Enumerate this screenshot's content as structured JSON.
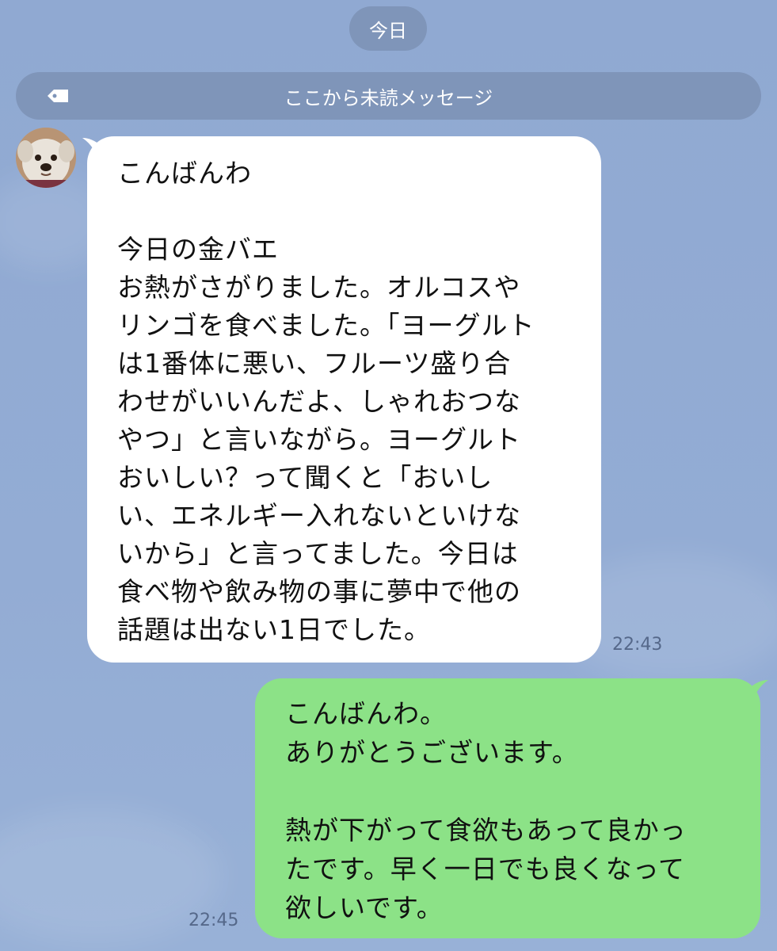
{
  "chat": {
    "date_label": "今日",
    "unread_label": "ここから未読メッセージ"
  },
  "incoming": {
    "avatar_icon": "dog-avatar-icon",
    "lines": [
      "こんばんわ",
      "",
      "今日の金バエ",
      "お熱がさがりました。オルコスや",
      "リンゴを食べました。「ヨーグルト",
      "は1番体に悪い、フルーツ盛り合",
      "わせがいいんだよ、しゃれおつな",
      "やつ」と言いながら。ヨーグルト",
      "おいしい？って聞くと「おいし",
      "い、エネルギー入れないといけな",
      "いから」と言ってました。今日は",
      "食べ物や飲み物の事に夢中で他の",
      "話題は出ない1日でした。"
    ],
    "time": "22:43"
  },
  "outgoing": {
    "lines": [
      "こんばんわ。",
      "ありがとうございます。",
      "",
      "熱が下がって食欲もあって良かっ",
      "たです。早く一日でも良くなって",
      "欲しいです。"
    ],
    "time": "22:45"
  },
  "colors": {
    "background": "#91aad3",
    "pill": "#7f95b9",
    "incoming_bubble": "#ffffff",
    "outgoing_bubble": "#8ce287",
    "timestamp": "#55688a"
  }
}
